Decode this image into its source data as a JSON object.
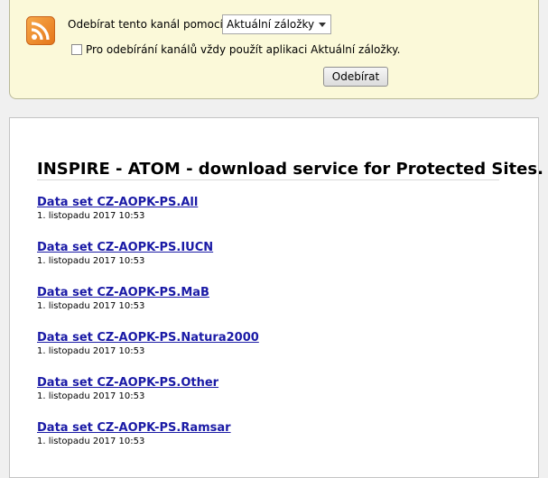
{
  "subscribe": {
    "label": "Odebírat tento kanál pomocí",
    "reader_selected": "Aktuální záložky",
    "always_use_label": "Pro odebírání kanálů vždy použít aplikaci Aktuální záložky.",
    "always_use_checked": false,
    "button_label": "Odebírat"
  },
  "feed": {
    "title": "INSPIRE - ATOM - download service for Protected Sites.",
    "entries": [
      {
        "title": "Data set CZ-AOPK-PS.All",
        "date": "1. listopadu 2017 10:53"
      },
      {
        "title": "Data set CZ-AOPK-PS.IUCN",
        "date": "1. listopadu 2017 10:53"
      },
      {
        "title": "Data set CZ-AOPK-PS.MaB",
        "date": "1. listopadu 2017 10:53"
      },
      {
        "title": "Data set CZ-AOPK-PS.Natura2000",
        "date": "1. listopadu 2017 10:53"
      },
      {
        "title": "Data set CZ-AOPK-PS.Other",
        "date": "1. listopadu 2017 10:53"
      },
      {
        "title": "Data set CZ-AOPK-PS.Ramsar",
        "date": "1. listopadu 2017 10:53"
      }
    ]
  },
  "colors": {
    "link": "#1a1aa6",
    "rss": "#f08a24",
    "box_bg": "#fbf9d9"
  }
}
